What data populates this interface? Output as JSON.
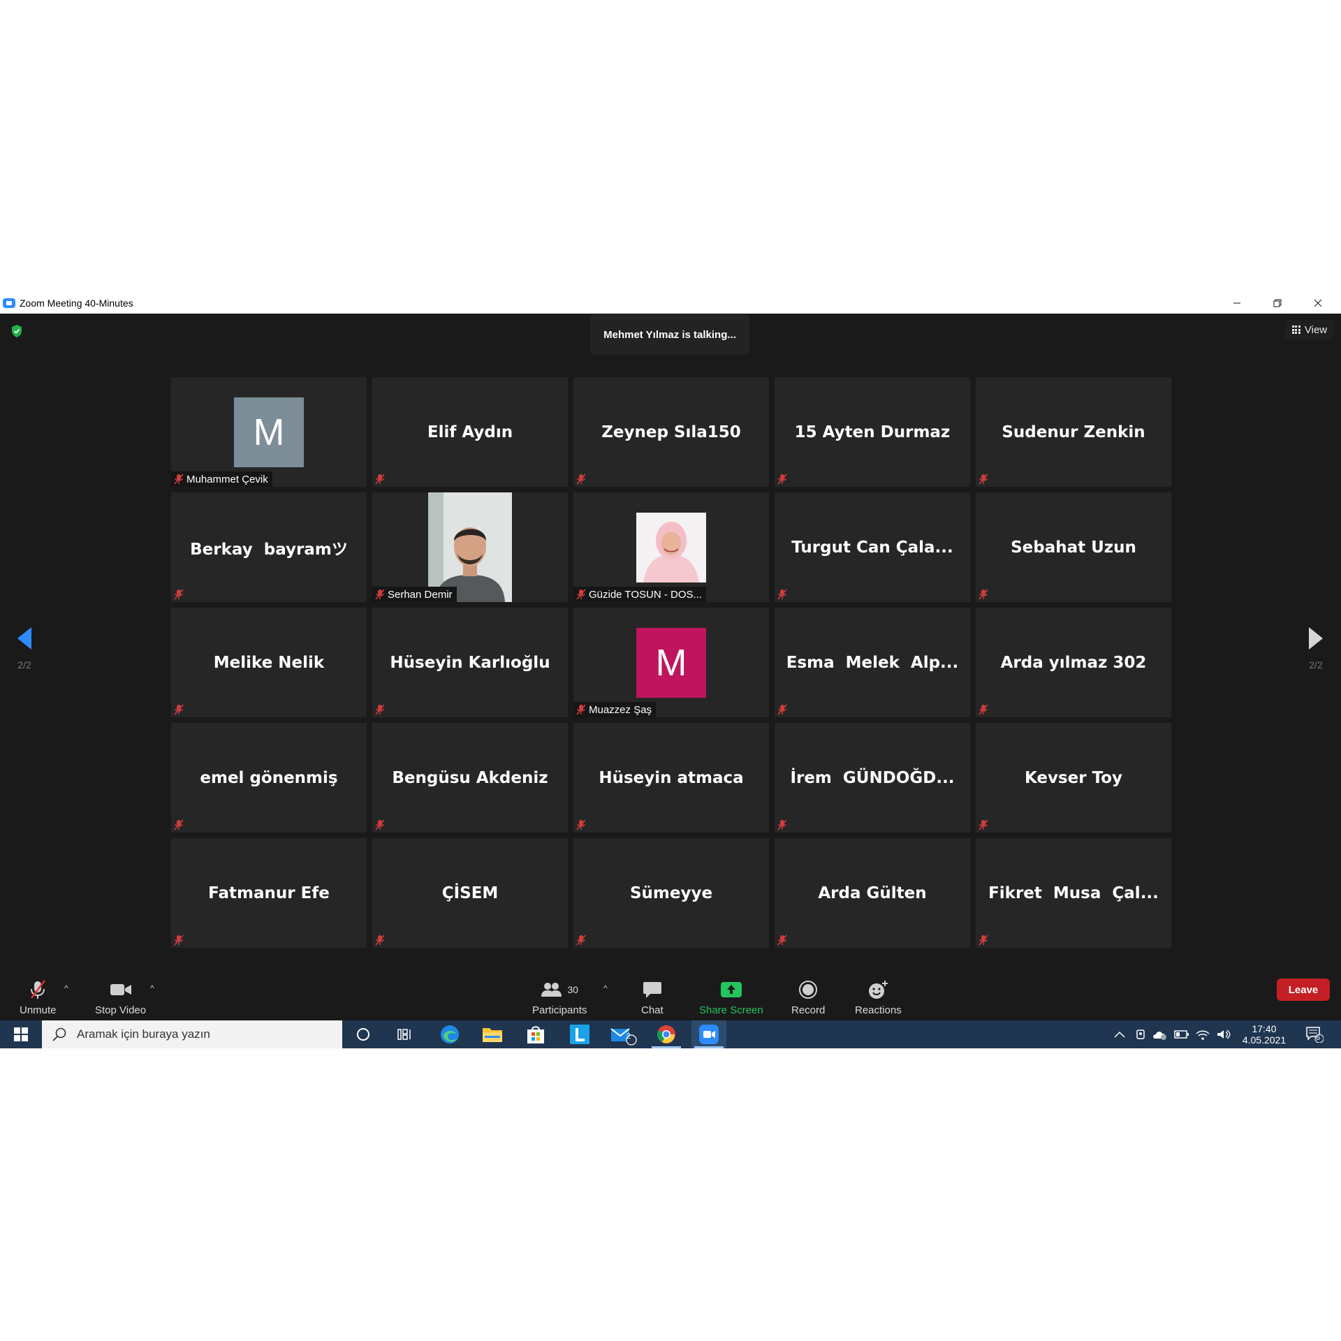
{
  "window": {
    "title": "Zoom Meeting 40-Minutes",
    "controls": [
      "minimize",
      "restore",
      "close"
    ]
  },
  "top_bar": {
    "talking_indicator": "Mehmet Yılmaz is talking...",
    "view_label": "View"
  },
  "pagination": {
    "left_label": "2/2",
    "right_label": "2/2"
  },
  "participants": [
    {
      "display": "avatar",
      "initial": "M",
      "avatar_color": "#7d8e99",
      "name": "Muhammet Çevik",
      "muted": true
    },
    {
      "display": "name",
      "name": "Elif Aydın",
      "muted": true
    },
    {
      "display": "name",
      "name": "Zeynep Sıla150",
      "muted": true
    },
    {
      "display": "name",
      "name": "15 Ayten Durmaz",
      "muted": true
    },
    {
      "display": "name",
      "name": "Sudenur Zenkin",
      "muted": true
    },
    {
      "display": "name",
      "name": "Berkay  bayramツ",
      "muted": true
    },
    {
      "display": "video",
      "name": "Serhan Demir",
      "muted": true
    },
    {
      "display": "photo",
      "name": "Güzide TOSUN - DOS...",
      "muted": true
    },
    {
      "display": "name",
      "name": "Turgut Can Çala...",
      "muted": true
    },
    {
      "display": "name",
      "name": "Sebahat Uzun",
      "muted": true
    },
    {
      "display": "name",
      "name": "Melike Nelik",
      "muted": true
    },
    {
      "display": "name",
      "name": "Hüseyin Karlıoğlu",
      "muted": true
    },
    {
      "display": "avatar",
      "initial": "M",
      "avatar_color": "#c0155e",
      "name": "Muazzez Şaş",
      "muted": true
    },
    {
      "display": "name",
      "name": "Esma  Melek  Alp...",
      "muted": true
    },
    {
      "display": "name",
      "name": "Arda yılmaz 302",
      "muted": true
    },
    {
      "display": "name",
      "name": "emel gönenmiş",
      "muted": true
    },
    {
      "display": "name",
      "name": "Bengüsu Akdeniz",
      "muted": true
    },
    {
      "display": "name",
      "name": "Hüseyin atmaca",
      "muted": true
    },
    {
      "display": "name",
      "name": "İrem  GÜNDOĞD...",
      "muted": true
    },
    {
      "display": "name",
      "name": "Kevser Toy",
      "muted": true
    },
    {
      "display": "name",
      "name": "Fatmanur Efe",
      "muted": true
    },
    {
      "display": "name",
      "name": "ÇİSEM",
      "muted": true
    },
    {
      "display": "name",
      "name": "Sümeyye",
      "muted": true
    },
    {
      "display": "name",
      "name": "Arda Gülten",
      "muted": true
    },
    {
      "display": "name",
      "name": "Fikret  Musa  Çal...",
      "muted": true
    }
  ],
  "toolbar": {
    "unmute_label": "Unmute",
    "stop_video_label": "Stop Video",
    "participants_label": "Participants",
    "participants_count": "30",
    "chat_label": "Chat",
    "share_screen_label": "Share Screen",
    "record_label": "Record",
    "reactions_label": "Reactions",
    "leave_label": "Leave",
    "share_color": "#22c55e",
    "leave_color": "#c31f24"
  },
  "taskbar": {
    "search_placeholder": "Aramak için buraya yazın",
    "mail_badge": "2",
    "clock_time": "17:40",
    "clock_date": "4.05.2021",
    "notification_count": "6"
  }
}
